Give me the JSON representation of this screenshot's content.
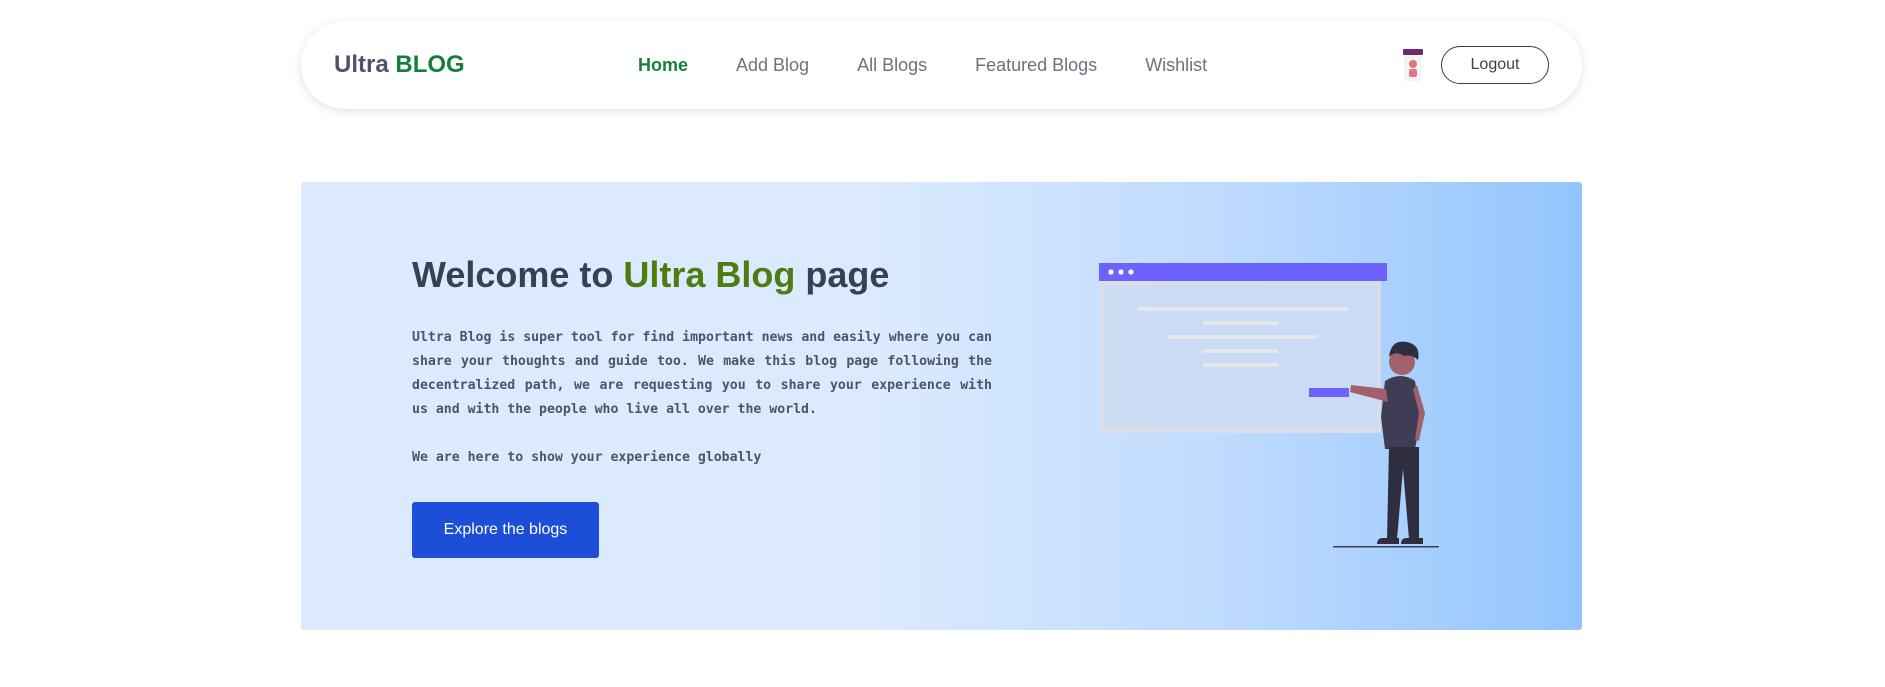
{
  "navbar": {
    "brand_prefix": "Ultra",
    "brand_accent": "BLOG",
    "links": [
      {
        "label": "Home",
        "active": true
      },
      {
        "label": "Add Blog",
        "active": false
      },
      {
        "label": "All Blogs",
        "active": false
      },
      {
        "label": "Featured Blogs",
        "active": false
      },
      {
        "label": "Wishlist",
        "active": false
      }
    ],
    "logout_label": "Logout"
  },
  "hero": {
    "title_prefix": "Welcome to",
    "title_accent": "Ultra Blog",
    "title_suffix": "page",
    "description": "Ultra Blog is super tool for find important news and easily where you can share your thoughts and guide too. We make this blog page following the decentralized path, we are requesting you to share your experience with us and with the people who live all over the world.",
    "tagline": "We are here to show your experience globally",
    "button_label": "Explore the blogs"
  },
  "icons": {
    "avatar": "user-avatar-icon",
    "illustration": "person-presenting-illustration"
  },
  "colors": {
    "accent_green": "#15803d",
    "title_green": "#4d7c0f",
    "button_blue": "#1d4ed8",
    "hero_bg_start": "#dbeafe",
    "hero_bg_end": "#93c5fd",
    "illustration_purple": "#6c63ff"
  }
}
